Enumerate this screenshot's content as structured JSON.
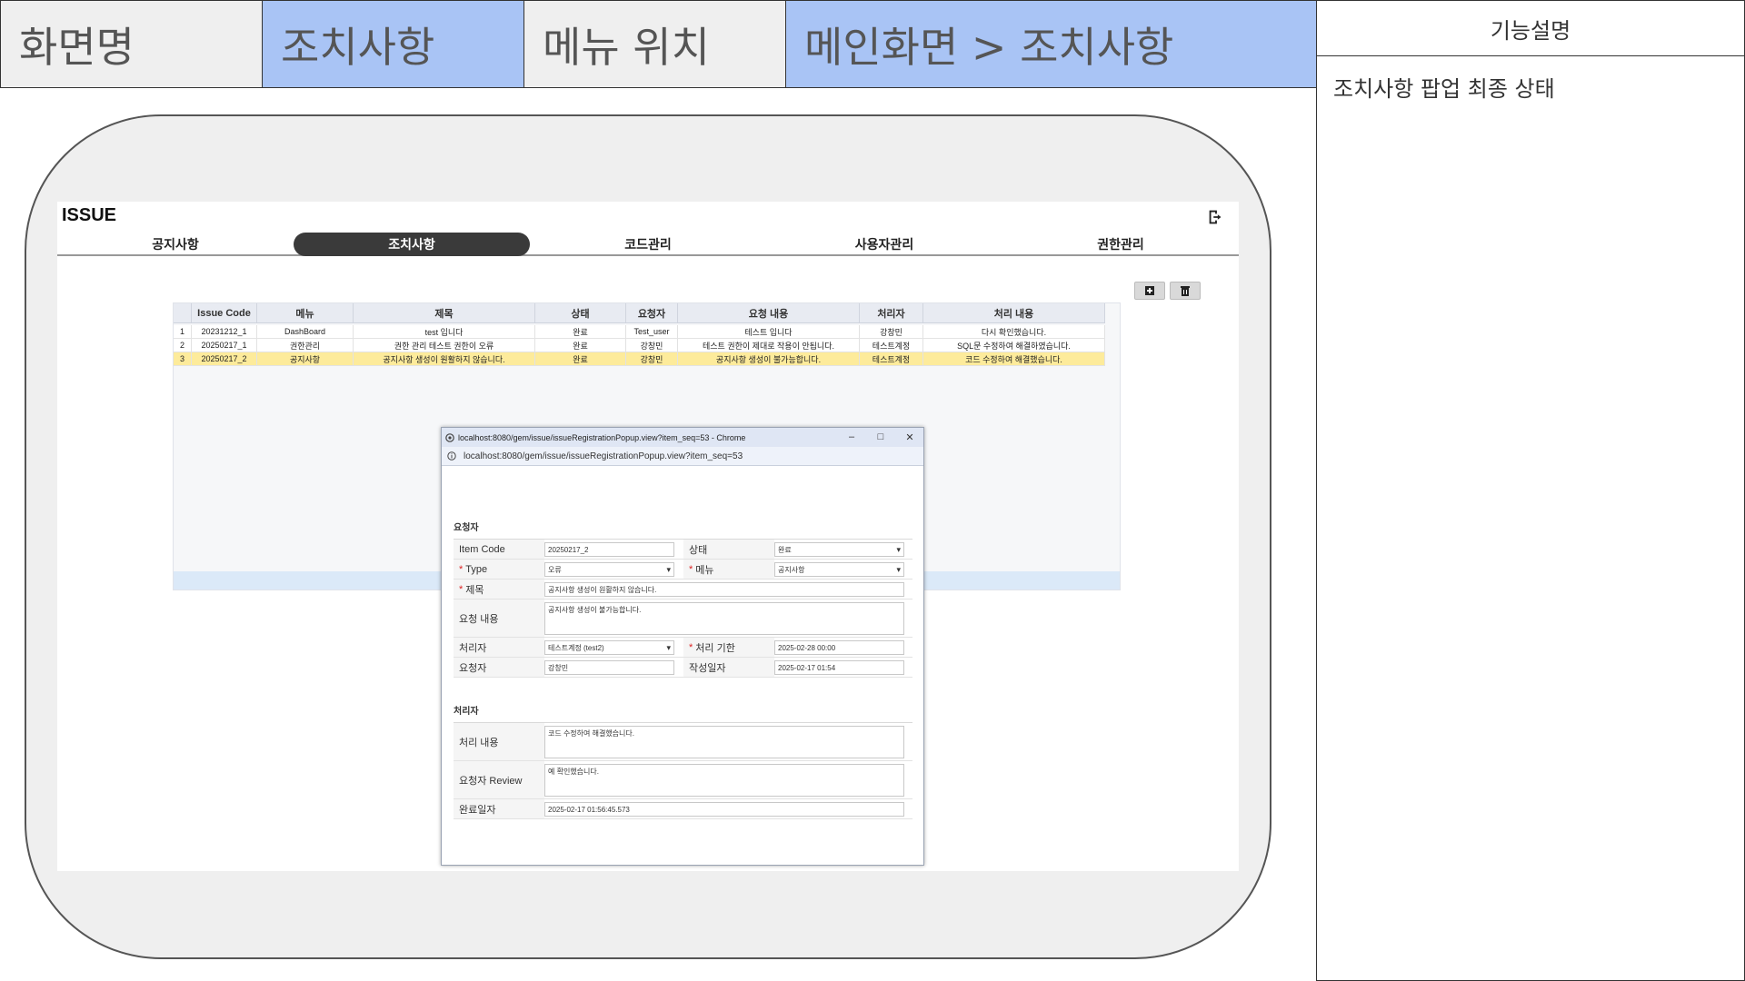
{
  "header": {
    "screen_name_label": "화면명",
    "screen_name_value": "조치사항",
    "menu_position_label": "메뉴 위치",
    "menu_position_value": "메인화면 > 조치사항"
  },
  "description": {
    "title": "기능설명",
    "text": "조치사항 팝업 최종 상태"
  },
  "app": {
    "title": "ISSUE",
    "tabs": [
      "공지사항",
      "조치사항",
      "코드관리",
      "사용자관리",
      "권한관리"
    ],
    "active_tab": 1,
    "grid": {
      "columns": [
        "",
        "Issue Code",
        "메뉴",
        "제목",
        "상태",
        "요청자",
        "요청 내용",
        "처리자",
        "처리 내용"
      ],
      "rows": [
        [
          "1",
          "20231212_1",
          "DashBoard",
          "test 입니다",
          "완료",
          "Test_user",
          "테스트 입니다",
          "강창민",
          "다시 확인했습니다."
        ],
        [
          "2",
          "20250217_1",
          "권한관리",
          "권한 관리 테스트 권한이 오류",
          "완료",
          "강창민",
          "테스트 권한이 제대로 작용이 안됩니다.",
          "테스트계정",
          "SQL문 수정하여 해결하였습니다."
        ],
        [
          "3",
          "20250217_2",
          "공지사항",
          "공지사항 생성이 원활하지 않습니다.",
          "완료",
          "강창민",
          "공지사항 생성이 불가능합니다.",
          "테스트계정",
          "코드 수정하여 해결했습니다."
        ]
      ],
      "selected_row": 2
    }
  },
  "popup": {
    "window_title": "localhost:8080/gem/issue/issueRegistrationPopup.view?item_seq=53 - Chrome",
    "address": "localhost:8080/gem/issue/issueRegistrationPopup.view?item_seq=53",
    "requester_section": "요청자",
    "handler_section": "처리자",
    "labels": {
      "item_code": "Item Code",
      "status": "상태",
      "type": "Type",
      "menu": "메뉴",
      "title": "제목",
      "request_content": "요청 내용",
      "handler": "처리자",
      "deadline": "처리 기한",
      "requester": "요청자",
      "created": "작성일자",
      "process_content": "처리 내용",
      "review": "요청자 Review",
      "completed": "완료일자"
    },
    "values": {
      "item_code": "20250217_2",
      "status": "완료",
      "type": "오류",
      "menu": "공지사항",
      "title": "공지사항 생성이 원활하지 않습니다.",
      "request_content": "공지사항 생성이 불가능합니다.",
      "handler": "테스트계정 (test2)",
      "deadline": "2025-02-28 00:00",
      "requester": "강창민",
      "created": "2025-02-17 01:54",
      "process_content": "코드 수정하여 해결했습니다.",
      "review": "예 확인했습니다.",
      "completed": "2025-02-17 01:56:45.573"
    },
    "required_mark": "*"
  }
}
